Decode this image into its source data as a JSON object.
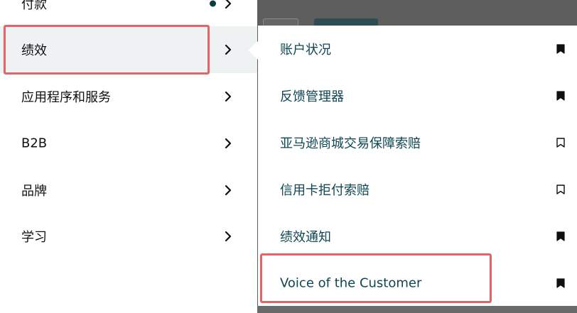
{
  "left_menu": {
    "items": [
      {
        "label": "付款",
        "has_dot": true
      },
      {
        "label": "绩效",
        "active": true
      },
      {
        "label": "应用程序和服务"
      },
      {
        "label": "B2B"
      },
      {
        "label": "品牌"
      },
      {
        "label": "学习"
      }
    ]
  },
  "sub_menu": {
    "items": [
      {
        "label": "账户状况",
        "bookmarked": true
      },
      {
        "label": "反馈管理器",
        "bookmarked": true
      },
      {
        "label": "亚马逊商城交易保障索赔",
        "bookmarked": false
      },
      {
        "label": "信用卡拒付索赔",
        "bookmarked": false
      },
      {
        "label": "绩效通知",
        "bookmarked": true
      },
      {
        "label": "Voice of the Customer",
        "bookmarked": true
      }
    ]
  },
  "colors": {
    "highlight": "#e06468",
    "submenu_text": "#0f4654",
    "dot": "#0e3a44"
  },
  "icons": {
    "chevron": "chevron-right-icon",
    "bookmark_filled": "bookmark-filled-icon",
    "bookmark_outline": "bookmark-outline-icon"
  }
}
